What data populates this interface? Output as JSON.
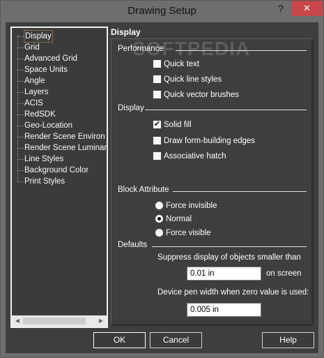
{
  "window": {
    "title": "Drawing Setup",
    "help_glyph": "?",
    "close_glyph": "✕"
  },
  "watermark": "SOFTPEDIA",
  "tree": {
    "items": [
      "Display",
      "Grid",
      "Advanced Grid",
      "Space Units",
      "Angle",
      "Layers",
      "ACIS",
      "RedSDK",
      "Geo-Location",
      "Render Scene Environ",
      "Render Scene Luminar",
      "Line Styles",
      "Background Color",
      "Print Styles"
    ],
    "selected": "Display"
  },
  "panel": {
    "title": "Display",
    "performance": {
      "label": "Performance",
      "options": [
        {
          "label": "Quick text",
          "checked": false
        },
        {
          "label": "Quick line styles",
          "checked": false
        },
        {
          "label": "Quick vector brushes",
          "checked": false
        }
      ]
    },
    "display": {
      "label": "Display",
      "options": [
        {
          "label": "Solid fill",
          "checked": true
        },
        {
          "label": "Draw form-building edges",
          "checked": false
        },
        {
          "label": "Associative hatch",
          "checked": false
        }
      ]
    },
    "block": {
      "label": "Block Attribute",
      "options": [
        {
          "label": "Force invisible",
          "selected": false
        },
        {
          "label": "Normal",
          "selected": true
        },
        {
          "label": "Force visible",
          "selected": false
        }
      ]
    },
    "defaults": {
      "label": "Defaults",
      "suppress_label": "Suppress display of objects smaller than",
      "suppress_value": "0.01 in",
      "on_screen": "on screen",
      "pen_label": "Device pen width when zero value is used:",
      "pen_value": "0.005 in"
    }
  },
  "buttons": {
    "ok": "OK",
    "cancel": "Cancel",
    "help": "Help"
  }
}
